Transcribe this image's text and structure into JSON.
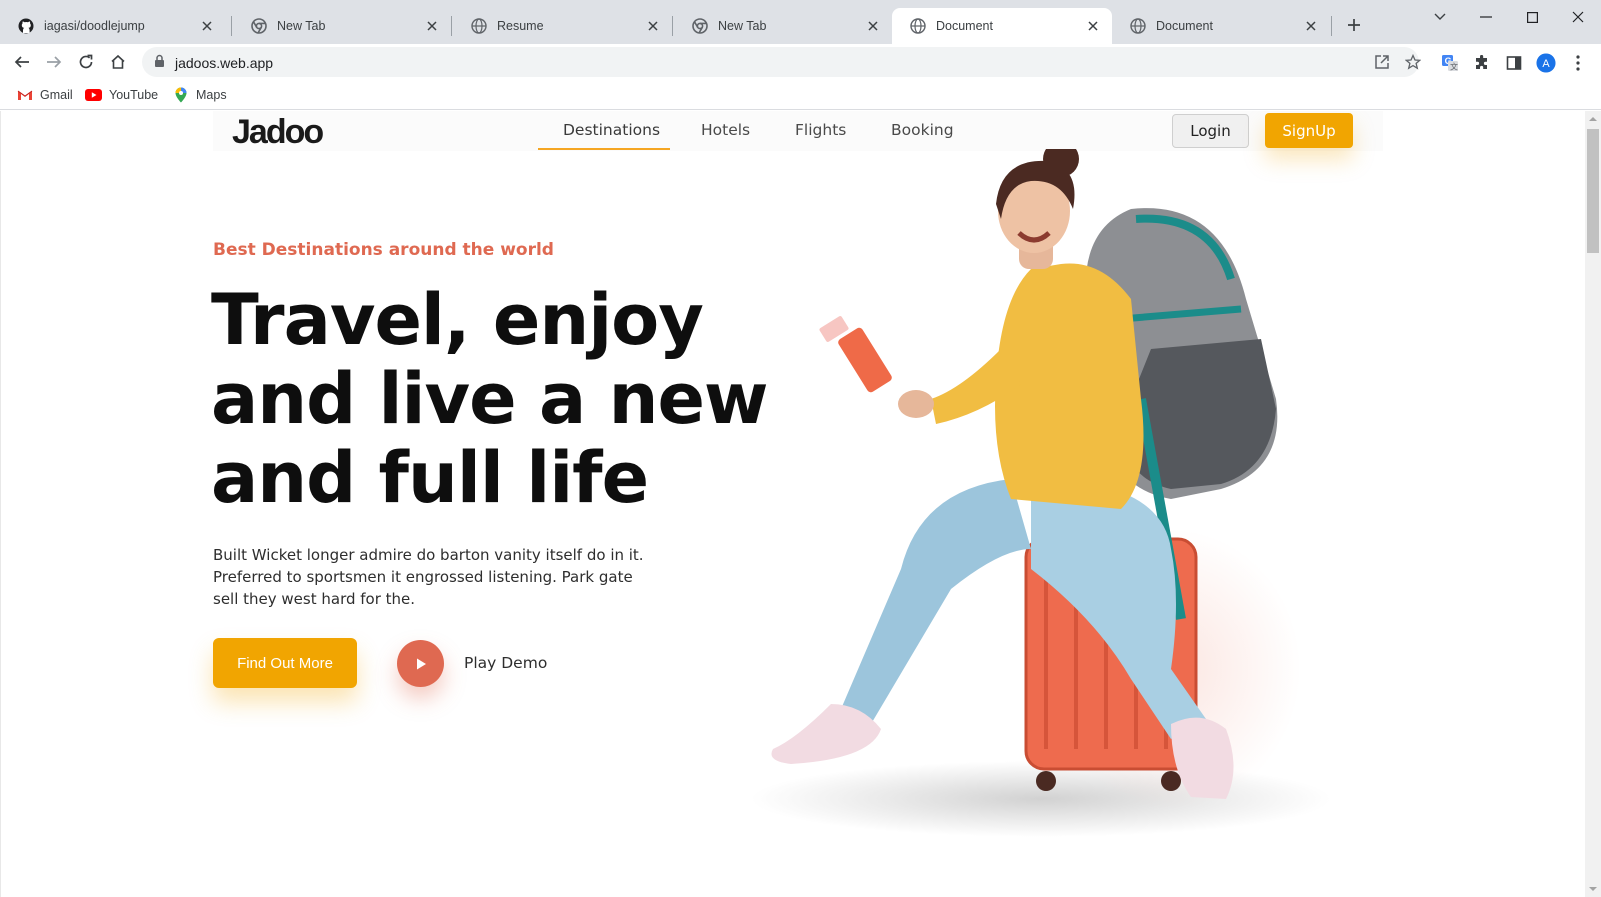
{
  "browser": {
    "tabs": [
      {
        "title": "iagasi/doodlejump",
        "icon": "github-icon",
        "active": false
      },
      {
        "title": "New Tab",
        "icon": "chrome-icon",
        "active": false
      },
      {
        "title": "Resume",
        "icon": "globe-icon",
        "active": false
      },
      {
        "title": "New Tab",
        "icon": "chrome-icon",
        "active": false
      },
      {
        "title": "Document",
        "icon": "globe-icon",
        "active": true
      },
      {
        "title": "Document",
        "icon": "globe-icon",
        "active": false
      }
    ],
    "url": "jadoos.web.app",
    "profile_initial": "A",
    "bookmarks": [
      {
        "label": "Gmail",
        "icon": "gmail-icon"
      },
      {
        "label": "YouTube",
        "icon": "youtube-icon"
      },
      {
        "label": "Maps",
        "icon": "maps-icon"
      }
    ]
  },
  "site": {
    "logo": "Jadoo",
    "nav": [
      "Destinations",
      "Hotels",
      "Flights",
      "Booking"
    ],
    "active_nav": "Destinations",
    "login_label": "Login",
    "signup_label": "SignUp"
  },
  "hero": {
    "eyebrow": "Best Destinations around the world",
    "headline": [
      "Travel, enjoy",
      "and live a new",
      "and full life"
    ],
    "description": [
      "Built Wicket longer admire do barton vanity itself do in it.",
      "Preferred to sportsmen it engrossed listening. Park gate",
      "sell they west hard for the."
    ],
    "cta_label": "Find Out More",
    "play_label": "Play Demo"
  },
  "colors": {
    "accent_yellow": "#f1a501",
    "accent_coral": "#df6951",
    "headline": "#0e0e0e"
  }
}
